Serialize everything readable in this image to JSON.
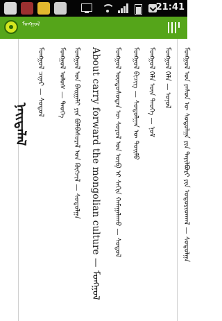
{
  "status_bar": {
    "time": "21:41",
    "icons": [
      "notification-icon",
      "app-icon",
      "star-icon",
      "usb-icon",
      "monitor-icon",
      "wifi-icon",
      "signal-icon",
      "battery-icon",
      "mail-icon"
    ]
  },
  "app_bar": {
    "title": "ᠮᠣᠩᠭᠣᠯ",
    "accent_color": "#55a51a",
    "menu_icon": "menu-bars-icon"
  },
  "page": {
    "heading": "ᠨᠡᠢᠲᠡᠯᠡᠯ",
    "list": [
      "ᠮᠣᠩᠭᠣᠯ ᠴᠢᠨᠠᠷ — ᠰᠤᠳᠤᠯ",
      "ᠮᠣᠩᠭᠣᠯ ᠤᠯᠤᠰ — ᠲᠡᠦᠬᠡ",
      "ᠮᠣᠩᠭᠣᠯ ᠤᠨ ᠪᠠᠢᠭᠠᠯᠢ ᠶᠢᠨ ᠪᠣᠯᠪᠠᠰᠤᠷᠠᠯ ᠤᠨ ᠬᠥᠭᠵᠢᠯ — ᠰᠤᠳᠤᠯᠭᠠ",
      "About carry forward the mongolian culture — ᠮᠣᠩᠭᠣᠯ",
      "ᠮᠣᠩᠭᠣᠯ ᠦᠨᠳᠦᠰᠦᠲᠡᠨ ᠦ ᠰᠣᠶᠣᠯ ᠤᠨ ᠥᠪ ᠢ ᠰᠠᠬᠢᠨ ᠬᠠᠮᠠᠭᠠᠯᠠᠬᠤ — ᠰᠤᠳᠤᠯ",
      "ᠮᠣᠩᠭᠣᠯ ᠪᠢᠴᠢᠭ — ᠰᠤᠳᠤᠯᠭᠠᠨ ᠦ ᠲᠣᠢᠮᠤ",
      "ᠮᠣᠩᠭᠣᠯ ᠬᠡᠯᠡ ᠦᠨ ᠲᠡᠦᠬᠡ — ᠨᠣᠮ",
      "ᠮᠣᠩᠭᠣᠯ ᠬᠡᠯᠡ — ᠣᠨᠣᠯ",
      "ᠮᠣᠩᠭᠣᠯ ᠤᠨ ᠶᠠᠰᠤᠨ ᠦ ᠰᠤᠳᠤᠯᠭᠠ ᠶᠢᠨ ᠲᠠᠶᠢᠯᠪᠤᠷᠢ ᠶᠢᠨ ᠤᠳᠤᠷᠢᠳᠬᠠᠯ — ᠰᠤᠳᠤᠯᠭᠠ"
    ]
  }
}
